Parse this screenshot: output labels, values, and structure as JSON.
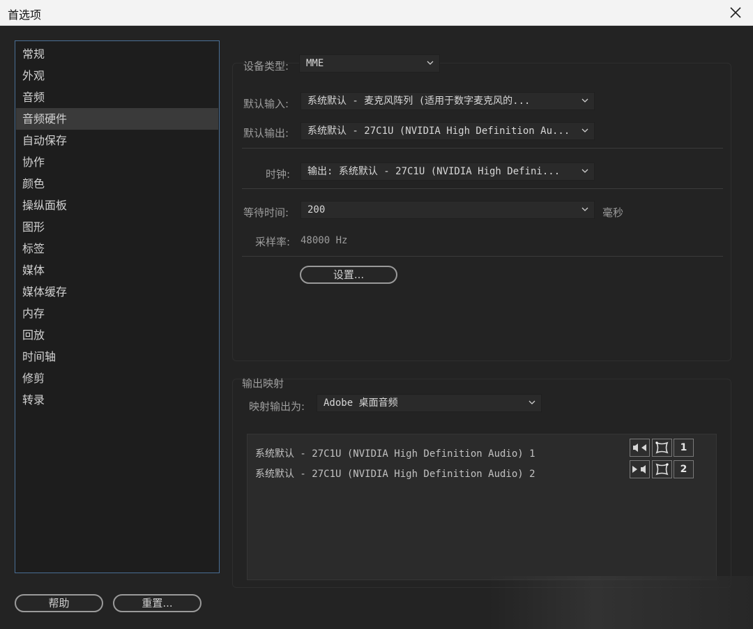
{
  "window": {
    "title": "首选项"
  },
  "sidebar": {
    "items": [
      {
        "label": "常规"
      },
      {
        "label": "外观"
      },
      {
        "label": "音频"
      },
      {
        "label": "音频硬件"
      },
      {
        "label": "自动保存"
      },
      {
        "label": "协作"
      },
      {
        "label": "颜色"
      },
      {
        "label": "操纵面板"
      },
      {
        "label": "图形"
      },
      {
        "label": "标签"
      },
      {
        "label": "媒体"
      },
      {
        "label": "媒体缓存"
      },
      {
        "label": "内存"
      },
      {
        "label": "回放"
      },
      {
        "label": "时间轴"
      },
      {
        "label": "修剪"
      },
      {
        "label": "转录"
      }
    ],
    "active_index": 3
  },
  "footer": {
    "help_label": "帮助",
    "reset_label": "重置..."
  },
  "hardware": {
    "device_type_label": "设备类型:",
    "device_type_value": "MME",
    "default_input_label": "默认输入:",
    "default_input_value": "系统默认 - 麦克风阵列 (适用于数字麦克风的...",
    "default_output_label": "默认输出:",
    "default_output_value": "系统默认 - 27C1U (NVIDIA High Definition Au...",
    "clock_label": "时钟:",
    "clock_value": "输出: 系统默认 - 27C1U (NVIDIA High Defini...",
    "latency_label": "等待时间:",
    "latency_value": "200",
    "latency_unit": "毫秒",
    "sample_rate_label": "采样率:",
    "sample_rate_value": "48000 Hz",
    "settings_button": "设置..."
  },
  "output_mapping": {
    "section_title": "输出映射",
    "map_label": "映射输出为:",
    "map_value": "Adobe 桌面音频",
    "channels": [
      {
        "label": "系统默认 - 27C1U (NVIDIA High Definition Audio) 1",
        "number": "1"
      },
      {
        "label": "系统默认 - 27C1U (NVIDIA High Definition Audio) 2",
        "number": "2"
      }
    ]
  }
}
